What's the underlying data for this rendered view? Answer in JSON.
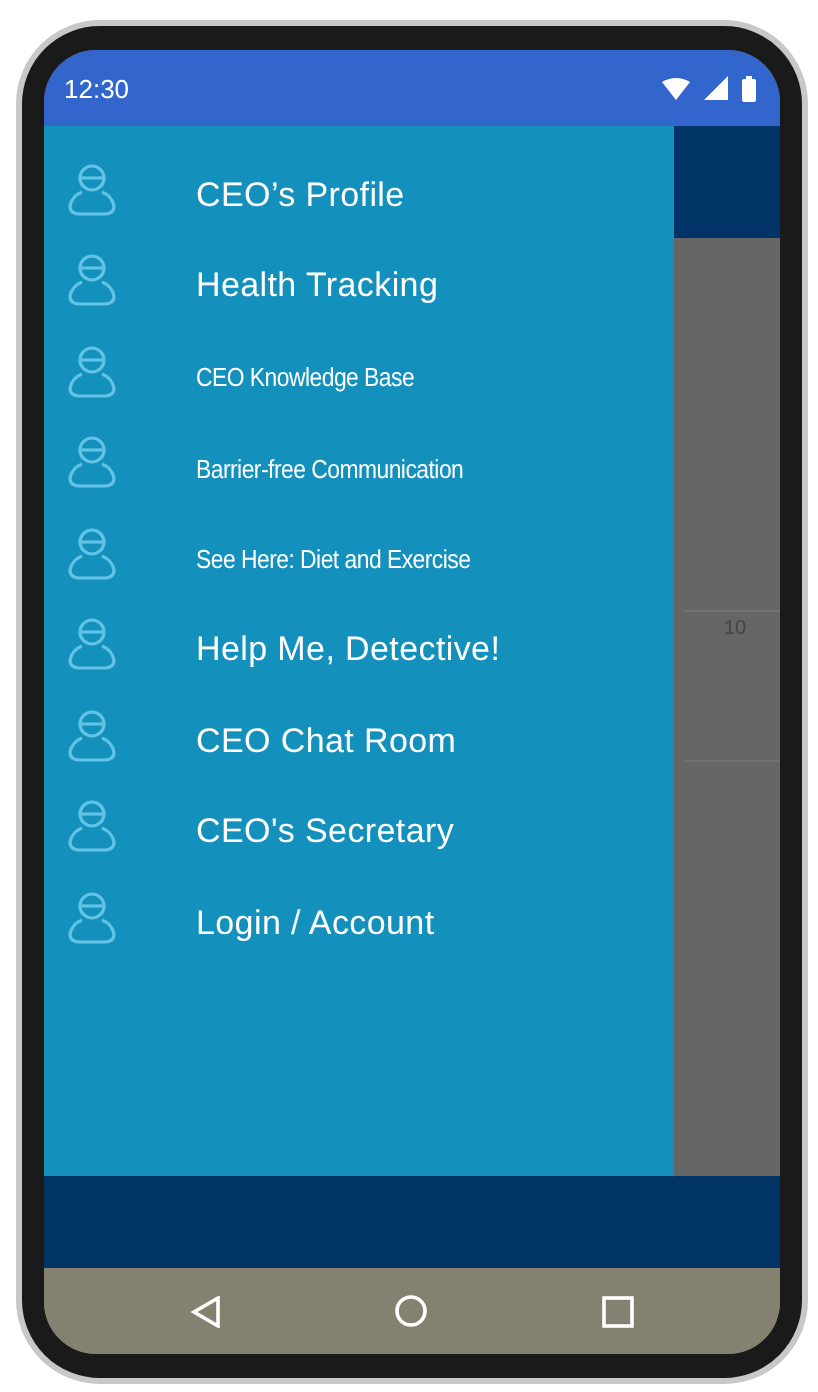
{
  "status_bar": {
    "time": "12:30"
  },
  "drawer": {
    "items": [
      {
        "label": "CEO’s Profile",
        "kind": "large"
      },
      {
        "label": "Health Tracking",
        "kind": "large"
      },
      {
        "label": "CEO Knowledge Base",
        "kind": "compact"
      },
      {
        "label": "Barrier-free Communication",
        "kind": "compact"
      },
      {
        "label": "See Here: Diet and Exercise",
        "kind": "compact"
      },
      {
        "label": "Help Me, Detective!",
        "kind": "large"
      },
      {
        "label": "CEO Chat Room",
        "kind": "large"
      },
      {
        "label": "CEO's Secretary",
        "kind": "large"
      },
      {
        "label": "Login / Account",
        "kind": "large"
      }
    ]
  },
  "background": {
    "value_label": "10"
  }
}
